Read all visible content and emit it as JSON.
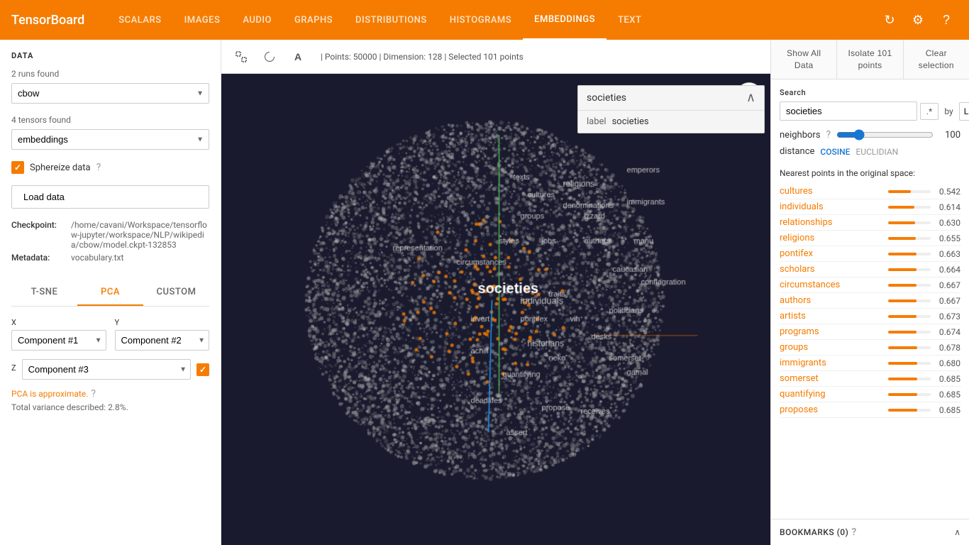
{
  "navbar": {
    "brand": "TensorBoard",
    "nav_items": [
      "SCALARS",
      "IMAGES",
      "AUDIO",
      "GRAPHS",
      "DISTRIBUTIONS",
      "HISTOGRAMS",
      "EMBEDDINGS",
      "TEXT"
    ],
    "active_item": "EMBEDDINGS"
  },
  "sidebar": {
    "section_title": "DATA",
    "runs_found_label": "2 runs found",
    "run_value": "cbow",
    "tensors_found_label": "4 tensors found",
    "tensor_value": "embeddings",
    "sphereize_label": "Sphereize data",
    "load_data_btn": "Load data",
    "checkpoint_label": "Checkpoint:",
    "checkpoint_value": "/home/cavani/Workspace/tensorflow-jupyter/workspace/NLP/wikipedia/cbow/model.ckpt-132853",
    "metadata_label": "Metadata:",
    "metadata_value": "vocabulary.txt",
    "tabs": [
      "T-SNE",
      "PCA",
      "CUSTOM"
    ],
    "active_tab": "PCA",
    "x_label": "X",
    "x_value": "Component #1",
    "y_label": "Y",
    "y_value": "Component #2",
    "z_label": "Z",
    "z_value": "Component #3",
    "pca_note": "PCA is approximate.",
    "variance_note": "Total variance described: 2.8%."
  },
  "canvas": {
    "info_text": "| Points: 50000 | Dimension: 128 | Selected 101 points",
    "words": [
      "texts",
      "religions",
      "emperors",
      "cultures",
      "denominations",
      "groups",
      "izzard",
      "representation",
      "styles",
      "jobs",
      "authors",
      "manu",
      "circumstances",
      "caucasian",
      "conflagration",
      "invert",
      "pontifex",
      "vih",
      "politicians",
      "traits",
      "individuals",
      "desks",
      "achill",
      "neko",
      "historians",
      "somerset",
      "gamal",
      "quantifying",
      "societies",
      "deadlifes",
      "propose",
      "receives",
      "assert",
      "immigrants",
      "groups"
    ]
  },
  "popup": {
    "title": "societies",
    "label_key": "label",
    "label_val": "societies"
  },
  "right_panel": {
    "btn_show_all": "Show All Data",
    "btn_isolate": "Isolate 101 points",
    "btn_clear": "Clear selection",
    "search_label": "Search",
    "search_value": "societies",
    "regex_label": ".*",
    "by_label": "by",
    "by_value": "Label",
    "neighbors_label": "neighbors",
    "neighbors_value": 100,
    "distance_label": "distance",
    "distance_cosine": "COSINE",
    "distance_euclidian": "EUCLIDIAN",
    "nearest_title": "Nearest points in the original space:",
    "nearest_points": [
      {
        "name": "cultures",
        "value": 0.542,
        "bar_pct": 54
      },
      {
        "name": "individuals",
        "value": 0.614,
        "bar_pct": 61
      },
      {
        "name": "relationships",
        "value": 0.63,
        "bar_pct": 63
      },
      {
        "name": "religions",
        "value": 0.655,
        "bar_pct": 65
      },
      {
        "name": "pontifex",
        "value": 0.663,
        "bar_pct": 66
      },
      {
        "name": "scholars",
        "value": 0.664,
        "bar_pct": 66
      },
      {
        "name": "circumstances",
        "value": 0.667,
        "bar_pct": 67
      },
      {
        "name": "authors",
        "value": 0.667,
        "bar_pct": 67
      },
      {
        "name": "artists",
        "value": 0.673,
        "bar_pct": 67
      },
      {
        "name": "programs",
        "value": 0.674,
        "bar_pct": 67
      },
      {
        "name": "groups",
        "value": 0.678,
        "bar_pct": 68
      },
      {
        "name": "immigrants",
        "value": 0.68,
        "bar_pct": 68
      },
      {
        "name": "somerset",
        "value": 0.685,
        "bar_pct": 69
      },
      {
        "name": "quantifying",
        "value": 0.685,
        "bar_pct": 69
      },
      {
        "name": "proposes",
        "value": 0.685,
        "bar_pct": 69
      }
    ],
    "bookmarks_title": "BOOKMARKS (0)"
  }
}
